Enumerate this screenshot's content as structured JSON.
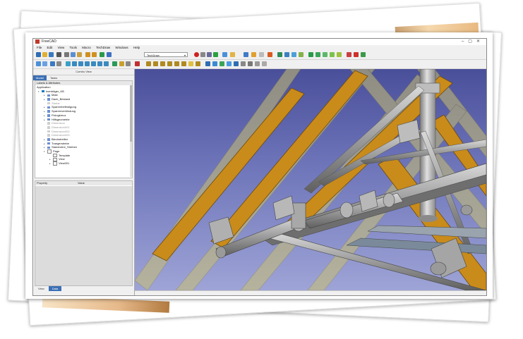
{
  "window": {
    "title": "FreeCAD"
  },
  "menu": [
    "File",
    "Edit",
    "View",
    "Tools",
    "Macro",
    "TechDraw",
    "Windows",
    "Help"
  ],
  "workbench_select": {
    "value": "TechDraw"
  },
  "combo_view": {
    "title": "Combo View",
    "tabs": [
      "Model",
      "Tasks"
    ],
    "active_tab": "Model"
  },
  "tree": {
    "header": "Labels & Attributes",
    "section": "Application",
    "items": [
      {
        "label": "Inenträger_KB",
        "icon": "part",
        "indent": 0,
        "expand": "open",
        "grey": false
      },
      {
        "label": "Mast",
        "icon": "folder",
        "indent": 1,
        "expand": "closed",
        "grey": false
      },
      {
        "label": "Dach_Bestand",
        "icon": "folder",
        "indent": 1,
        "expand": "closed",
        "grey": false
      },
      {
        "label": "Strebe",
        "icon": "dim",
        "indent": 1,
        "expand": "none",
        "grey": true
      },
      {
        "label": "Sparrenbefestigung",
        "icon": "folder",
        "indent": 1,
        "expand": "closed",
        "grey": false
      },
      {
        "label": "Sparrenverbindung",
        "icon": "folder",
        "indent": 1,
        "expand": "closed",
        "grey": false
      },
      {
        "label": "Fixingkreuz",
        "icon": "folder",
        "indent": 1,
        "expand": "closed",
        "grey": false
      },
      {
        "label": "Hilfsgeometrie",
        "icon": "folder",
        "indent": 1,
        "expand": "closed",
        "grey": false
      },
      {
        "label": "Dimension",
        "icon": "dim",
        "indent": 1,
        "expand": "none",
        "grey": true
      },
      {
        "label": "Dimension001",
        "icon": "dim",
        "indent": 1,
        "expand": "none",
        "grey": true
      },
      {
        "label": "Dimension002",
        "icon": "dim",
        "indent": 1,
        "expand": "none",
        "grey": true
      },
      {
        "label": "Dimension003",
        "icon": "dim",
        "indent": 1,
        "expand": "none",
        "grey": true
      },
      {
        "label": "Blechstreifen",
        "icon": "folder",
        "indent": 1,
        "expand": "closed",
        "grey": false
      },
      {
        "label": "Traegerstrebe",
        "icon": "folder",
        "indent": 1,
        "expand": "closed",
        "grey": false
      },
      {
        "label": "Standrohre_Streben",
        "icon": "folder",
        "indent": 1,
        "expand": "closed",
        "grey": false
      },
      {
        "label": "Page",
        "icon": "page",
        "indent": 1,
        "expand": "open",
        "grey": false
      },
      {
        "label": "Template",
        "icon": "page",
        "indent": 2,
        "expand": "none",
        "grey": false
      },
      {
        "label": "View",
        "icon": "page",
        "indent": 2,
        "expand": "closed",
        "grey": false
      },
      {
        "label": "View001",
        "icon": "page",
        "indent": 2,
        "expand": "closed",
        "grey": false
      }
    ]
  },
  "property_view": {
    "col_property": "Property",
    "col_value": "Value"
  },
  "bottom_tabs": [
    "View",
    "Data"
  ],
  "bottom_active_tab": "Data",
  "colors": {
    "accent": "#3c6fb5",
    "beam_wood": "#c98b1a",
    "beam_wood_translucent": "#c9c070",
    "steel": "#9a9a9a",
    "sky_top": "#4a4f9a",
    "sky_bottom": "#9ea4d6"
  },
  "toolbar_icons": [
    "new-file-icon",
    "open-icon",
    "save-icon",
    "print-icon",
    "cut-icon",
    "copy-icon",
    "paste-icon",
    "undo-icon",
    "redo-icon",
    "refresh-icon",
    "whatsthis-icon",
    "macro-record-icon",
    "macro-stop-icon",
    "macro-edit-icon",
    "macro-run-icon"
  ]
}
